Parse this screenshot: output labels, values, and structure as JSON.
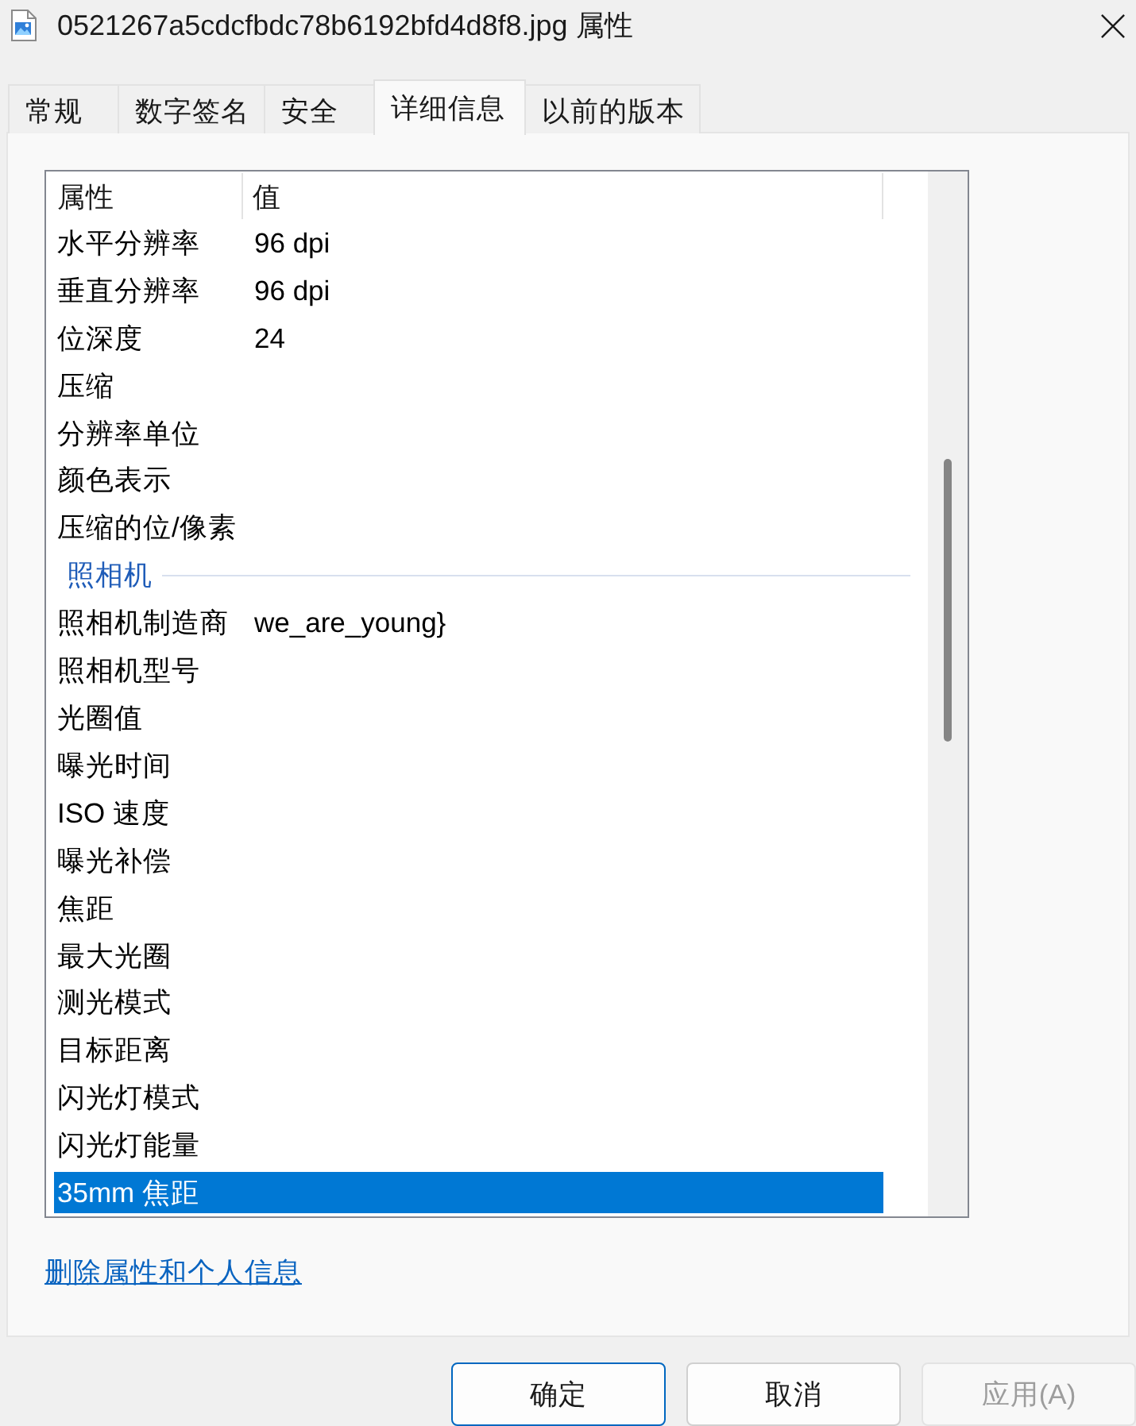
{
  "window": {
    "title": "0521267a5cdcfbdc78b6192bfd4d8f8.jpg 属性"
  },
  "tabs": [
    {
      "label": "常规",
      "selected": false
    },
    {
      "label": "数字签名",
      "selected": false
    },
    {
      "label": "安全",
      "selected": false
    },
    {
      "label": "详细信息",
      "selected": true
    },
    {
      "label": "以前的版本",
      "selected": false
    }
  ],
  "details": {
    "columns": [
      "属性",
      "值"
    ],
    "rows": [
      {
        "kind": "property",
        "name": "水平分辨率",
        "value": "96 dpi",
        "selected": false
      },
      {
        "kind": "property",
        "name": "垂直分辨率",
        "value": "96 dpi",
        "selected": false
      },
      {
        "kind": "property",
        "name": "位深度",
        "value": "24",
        "selected": false
      },
      {
        "kind": "property",
        "name": "压缩",
        "selected": false
      },
      {
        "kind": "property",
        "name": "分辨率单位",
        "selected": false
      },
      {
        "kind": "property",
        "name": "颜色表示",
        "selected": false
      },
      {
        "kind": "property",
        "name": "压缩的位/像素",
        "selected": false
      },
      {
        "kind": "group",
        "name": "照相机",
        "selected": false
      },
      {
        "kind": "property",
        "name": "照相机制造商",
        "value": "we_are_young}",
        "selected": false
      },
      {
        "kind": "property",
        "name": "照相机型号",
        "selected": false
      },
      {
        "kind": "property",
        "name": "光圈值",
        "selected": false
      },
      {
        "kind": "property",
        "name": "曝光时间",
        "selected": false
      },
      {
        "kind": "property",
        "name": "ISO 速度",
        "selected": false
      },
      {
        "kind": "property",
        "name": "曝光补偿",
        "selected": false
      },
      {
        "kind": "property",
        "name": "焦距",
        "selected": false
      },
      {
        "kind": "property",
        "name": "最大光圈",
        "selected": false
      },
      {
        "kind": "property",
        "name": "测光模式",
        "selected": false
      },
      {
        "kind": "property",
        "name": "目标距离",
        "selected": false
      },
      {
        "kind": "property",
        "name": "闪光灯模式",
        "selected": false
      },
      {
        "kind": "property",
        "name": "闪光灯能量",
        "selected": false
      },
      {
        "kind": "property",
        "name": "35mm 焦距",
        "selected": true
      }
    ]
  },
  "remove_link": "删除属性和个人信息",
  "buttons": [
    {
      "label": "确定",
      "default": true,
      "disabled": false
    },
    {
      "label": "取消",
      "default": false,
      "disabled": false
    },
    {
      "label": "应用(A)",
      "default": false,
      "disabled": true
    }
  ]
}
